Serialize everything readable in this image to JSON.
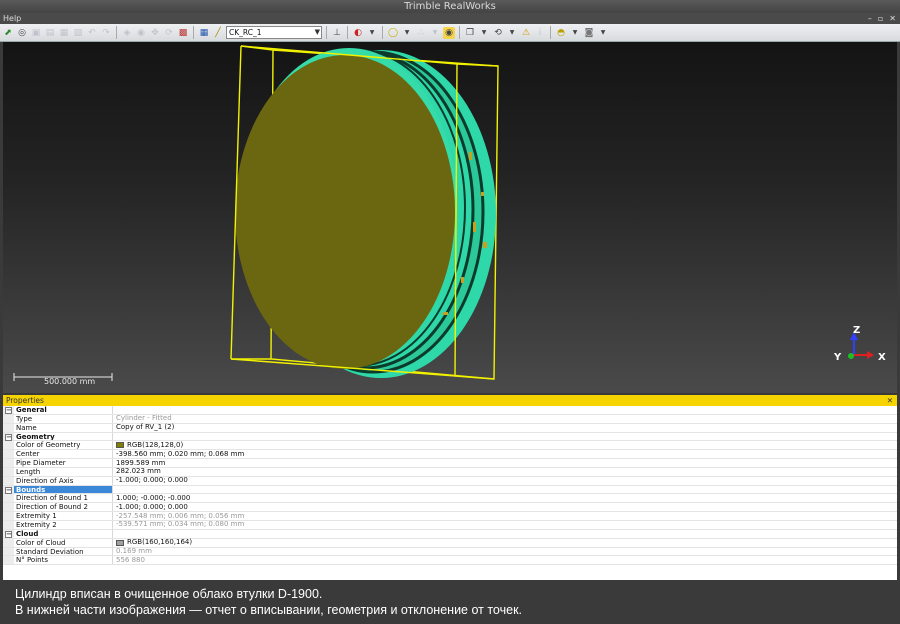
{
  "window": {
    "title": "Trimble RealWorks",
    "menu_help": "Help",
    "min": "–",
    "max": "▫",
    "close": "✕"
  },
  "toolbar": {
    "cloud_select": "CK_RC_1"
  },
  "viewport": {
    "scale_bar_label": "500.000 mm",
    "axis_z": "Z",
    "axis_y": "Y",
    "axis_x": "X",
    "colors": {
      "cylinder_face": "#6b6710",
      "cloud": "#2fd8a8",
      "bbox": "#f2f200"
    }
  },
  "properties": {
    "header": "Properties",
    "close": "✕",
    "rows": [
      {
        "kind": "cat",
        "key": "General",
        "toggle": "−"
      },
      {
        "kind": "prop",
        "key": "Type",
        "value": "Cylinder - Fitted",
        "grey": true
      },
      {
        "kind": "prop",
        "key": "Name",
        "value": "Copy of RV_1 (2)"
      },
      {
        "kind": "cat",
        "key": "Geometry",
        "toggle": "−"
      },
      {
        "kind": "prop",
        "key": "Color of Geometry",
        "value": "RGB(128,128,0)",
        "swatch": "#808000"
      },
      {
        "kind": "prop",
        "key": "Center",
        "value": "-398.560 mm; 0.020 mm; 0.068 mm"
      },
      {
        "kind": "prop",
        "key": "Pipe Diameter",
        "value": "1899.589 mm"
      },
      {
        "kind": "prop",
        "key": "Length",
        "value": "282.023 mm"
      },
      {
        "kind": "prop",
        "key": "Direction of Axis",
        "value": "-1.000; 0.000; 0.000"
      },
      {
        "kind": "cat",
        "key": "Bounds",
        "toggle": "−",
        "selected": true
      },
      {
        "kind": "prop",
        "key": "Direction of Bound 1",
        "value": "1.000; -0.000; -0.000"
      },
      {
        "kind": "prop",
        "key": "Direction of Bound 2",
        "value": "-1.000; 0.000; 0.000"
      },
      {
        "kind": "prop",
        "key": "Extremity 1",
        "value": "-257.548 mm; 0.006 mm; 0.056 mm",
        "grey": true
      },
      {
        "kind": "prop",
        "key": "Extremity 2",
        "value": "-539.571 mm; 0.034 mm; 0.080 mm",
        "grey": true
      },
      {
        "kind": "cat",
        "key": "Cloud",
        "toggle": "−"
      },
      {
        "kind": "prop",
        "key": "Color of Cloud",
        "value": "RGB(160,160,164)",
        "swatch": "#a0a0a4"
      },
      {
        "kind": "prop",
        "key": "Standard Deviation",
        "value": "0.169 mm",
        "grey": true
      },
      {
        "kind": "prop",
        "key": "N° Points",
        "value": "556 880",
        "grey": true
      }
    ]
  },
  "caption": {
    "line1": "Цилиндр вписан в очищенное облако втулки D-1900.",
    "line2": "В нижней части изображения — отчет о вписывании, геометрия и отклонение от точек."
  }
}
